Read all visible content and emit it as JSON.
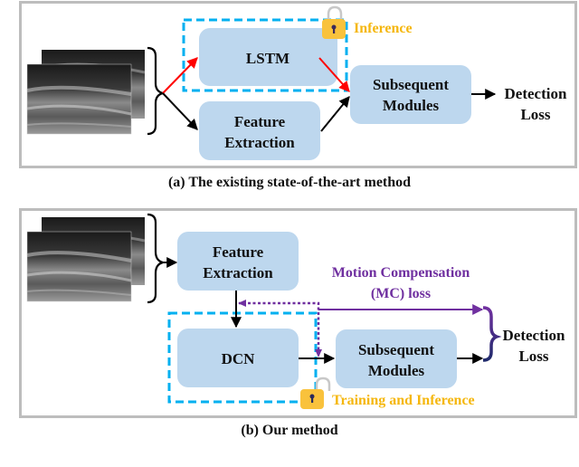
{
  "colors": {
    "module_fill": "#bdd7ee",
    "dashed_box": "#00b0f0",
    "red_arrow": "#ff0000",
    "purple": "#7030a0",
    "lock": "#f9c23c",
    "lock_tag_text": "#f5b70e",
    "frame": "#bdbdbd"
  },
  "panel_a": {
    "caption": "(a) The existing state-of-the-art method",
    "modules": {
      "lstm": "LSTM",
      "feature_extraction": [
        "Feature",
        "Extraction"
      ],
      "subsequent_modules": [
        "Subsequent",
        "Modules"
      ]
    },
    "lock_tag": "Inference",
    "output": [
      "Detection",
      "Loss"
    ],
    "input_icon": "video-frames-icon"
  },
  "panel_b": {
    "caption": "(b) Our method",
    "modules": {
      "feature_extraction": [
        "Feature",
        "Extraction"
      ],
      "dcn": "DCN",
      "subsequent_modules": [
        "Subsequent",
        "Modules"
      ]
    },
    "mc_loss": [
      "Motion Compensation",
      "(MC) loss"
    ],
    "lock_tag": "Training and Inference",
    "output": [
      "Detection",
      "Loss"
    ],
    "input_icon": "video-frames-icon"
  }
}
